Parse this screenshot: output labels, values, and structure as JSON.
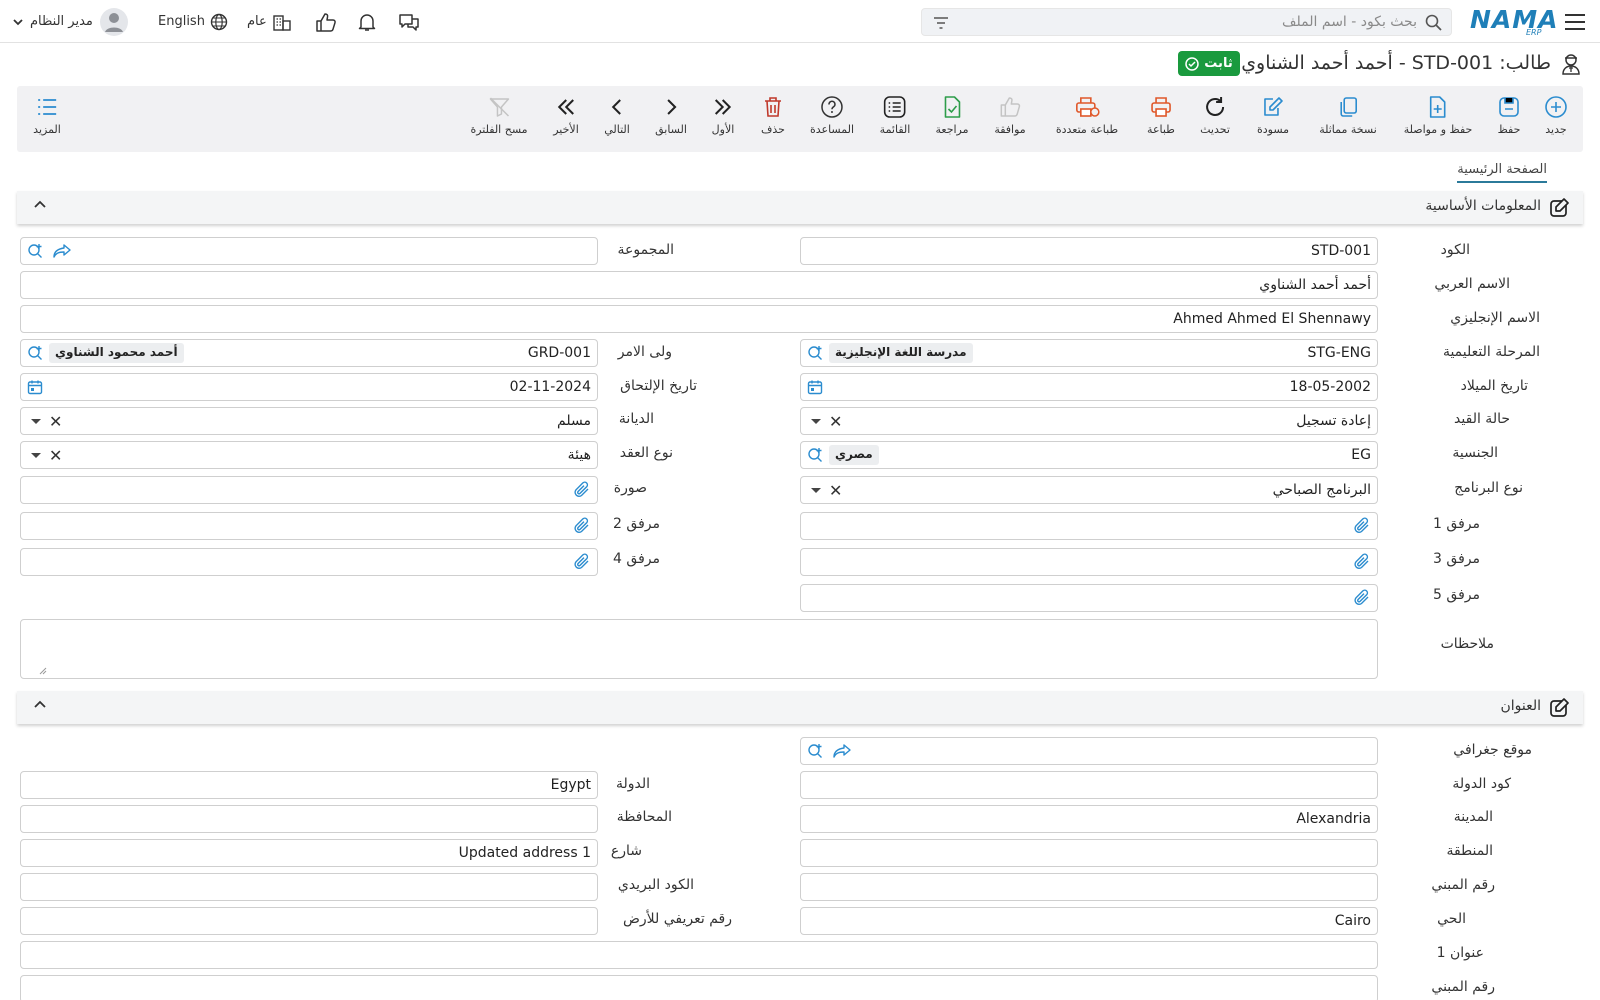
{
  "header": {
    "logo_text": "NAMA",
    "logo_sub": "ERP",
    "search_placeholder": "بحث بكود - اسم الملف",
    "user_name": "مدير النظام",
    "language": "English",
    "context": "عام"
  },
  "page": {
    "title": "طالب: STD-001 - أحمد أحمد الشناوي",
    "status": "ثابت"
  },
  "toolbar": {
    "new": "جديد",
    "save": "حفظ",
    "save_continue": "حفظ و مواصلة",
    "duplicate": "نسخة مماثلة",
    "draft": "مسودة",
    "refresh": "تحديث",
    "print": "طباعة",
    "multi_print": "طباعة متعددة",
    "approve": "موافقة",
    "review": "مراجعة",
    "list": "القائمة",
    "help": "المساعدة",
    "delete": "حذف",
    "first": "الأول",
    "previous": "السابق",
    "next": "التالي",
    "last": "الأخير",
    "clear_filter": "مسح الفلترة",
    "more": "المزيد"
  },
  "tabs": {
    "main": "الصفحة الرئيسية"
  },
  "sections": {
    "basic": "المعلومات الأساسية",
    "address": "العنوان"
  },
  "basic": {
    "code": {
      "label": "الكود",
      "value": "STD-001"
    },
    "group": {
      "label": "المجموعة",
      "value": ""
    },
    "arabic_name": {
      "label": "الاسم العربي",
      "value": "أحمد أحمد الشناوي"
    },
    "english_name": {
      "label": "الاسم الإنجليزي",
      "value": "Ahmed Ahmed El Shennawy"
    },
    "stage": {
      "label": "المرحلة التعليمية",
      "code": "STG-ENG",
      "name": "مدرسة اللغة الإنجليزية"
    },
    "guardian": {
      "label": "ولى الامر",
      "code": "GRD-001",
      "name": "أحمد محمود الشناوي"
    },
    "birth_date": {
      "label": "تاريخ الميلاد",
      "value": "18-05-2002"
    },
    "join_date": {
      "label": "تاريخ الإلتحاق",
      "value": "02-11-2024"
    },
    "enroll_status": {
      "label": "حالة القيد",
      "value": "إعادة تسجيل"
    },
    "religion": {
      "label": "الديانة",
      "value": "مسلم"
    },
    "nationality": {
      "label": "الجنسية",
      "code": "EG",
      "name": "مصري"
    },
    "contract_type": {
      "label": "نوع العقد",
      "value": "هيئة"
    },
    "program_type": {
      "label": "نوع البرنامج",
      "value": "البرنامج الصباحي"
    },
    "photo": {
      "label": "صورة"
    },
    "attach1": {
      "label": "مرفق 1"
    },
    "attach2": {
      "label": "مرفق 2"
    },
    "attach3": {
      "label": "مرفق 3"
    },
    "attach4": {
      "label": "مرفق 4"
    },
    "attach5": {
      "label": "مرفق 5"
    },
    "notes": {
      "label": "ملاحظات",
      "value": ""
    }
  },
  "address": {
    "geo": {
      "label": "موقع جغرافي",
      "value": ""
    },
    "country_code": {
      "label": "كود الدولة",
      "value": ""
    },
    "country": {
      "label": "الدولة",
      "value": "Egypt"
    },
    "city": {
      "label": "المدينة",
      "value": "Alexandria"
    },
    "governorate": {
      "label": "المحافظة",
      "value": ""
    },
    "region": {
      "label": "المنطقة",
      "value": ""
    },
    "street": {
      "label": "شارع",
      "value": "Updated address 1"
    },
    "building_no": {
      "label": "رقم المبني",
      "value": ""
    },
    "postal_code": {
      "label": "الكود البريدي",
      "value": ""
    },
    "district": {
      "label": "الحي",
      "value": "Cairo"
    },
    "land_id": {
      "label": "رقم تعريفي للأرض",
      "value": ""
    },
    "address1": {
      "label": "عنوان 1",
      "value": ""
    },
    "building_no2": {
      "label": "رقم المبني",
      "value": ""
    }
  },
  "colors": {
    "brand": "#1f7fb8",
    "status_green": "#1a9a3e",
    "print_orange": "#e0582a",
    "delete_red": "#c0392b",
    "review_green": "#2e9d4a",
    "link_blue": "#2b8ccf"
  }
}
